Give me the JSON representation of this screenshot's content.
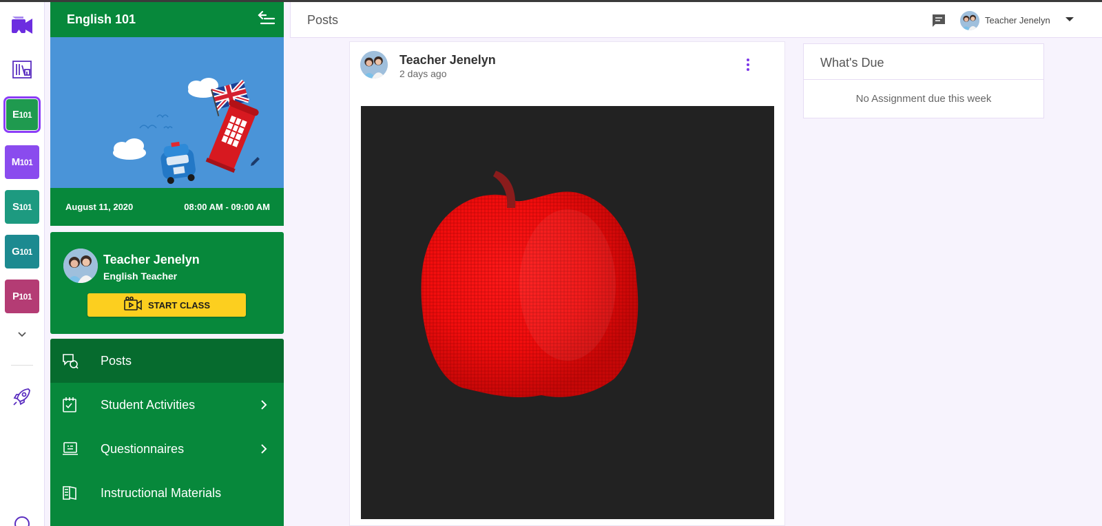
{
  "rail": {
    "courses": [
      {
        "letter": "E",
        "num": "101",
        "color": "#1f9a4f",
        "active": true
      },
      {
        "letter": "M",
        "num": "101",
        "color": "#8a4bee",
        "active": false
      },
      {
        "letter": "S",
        "num": "101",
        "color": "#1d9a80",
        "active": false
      },
      {
        "letter": "G",
        "num": "101",
        "color": "#1c8a90",
        "active": false
      },
      {
        "letter": "P",
        "num": "101",
        "color": "#b43c74",
        "active": false
      }
    ],
    "icons": [
      "video-class-icon",
      "library-icon",
      "expand-chevron-icon",
      "rocket-icon",
      "help-icon"
    ]
  },
  "panel": {
    "title": "English 101",
    "date": "August 11, 2020",
    "time": "08:00 AM - 09:00 AM",
    "teacher_name": "Teacher Jenelyn",
    "teacher_role": "English Teacher",
    "start_label": "START CLASS"
  },
  "nav": {
    "items": [
      {
        "label": "Posts",
        "icon": "posts-icon",
        "active": true,
        "chevron": false
      },
      {
        "label": "Student Activities",
        "icon": "activities-icon",
        "active": false,
        "chevron": true
      },
      {
        "label": "Questionnaires",
        "icon": "questionnaires-icon",
        "active": false,
        "chevron": true
      },
      {
        "label": "Instructional Materials",
        "icon": "materials-icon",
        "active": false,
        "chevron": false
      }
    ]
  },
  "topbar": {
    "title": "Posts",
    "user_name": "Teacher Jenelyn"
  },
  "post": {
    "author": "Teacher Jenelyn",
    "time": "2 days ago"
  },
  "due": {
    "title": "What's Due",
    "empty": "No Assignment due this week"
  },
  "colors": {
    "brand_green": "#07883b",
    "active_green": "#066b2e",
    "accent_purple": "#7b35e8",
    "start_yellow": "#fccf1f"
  }
}
